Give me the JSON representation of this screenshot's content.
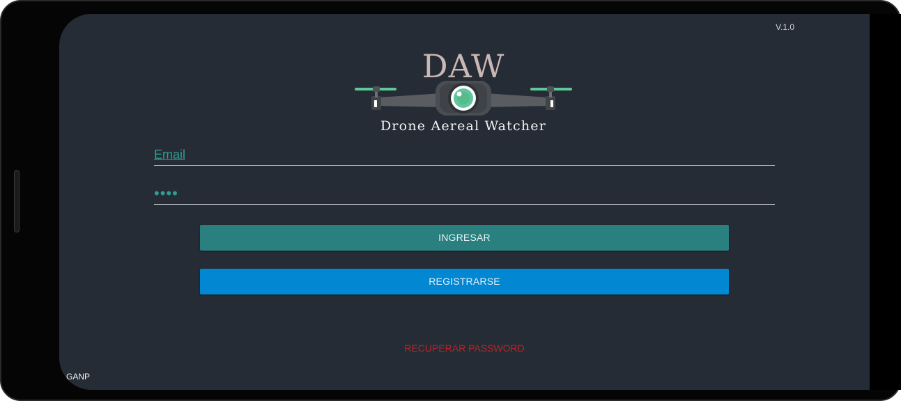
{
  "app": {
    "version": "V.1.0",
    "logo_title": "DAW",
    "logo_subtitle": "Drone Aereal Watcher",
    "footer_tag": "GANP"
  },
  "login_form": {
    "email_placeholder": "Email",
    "password_value": "••••",
    "login_label": "INGRESAR",
    "register_label": "REGISTRARSE",
    "recover_label": "RECUPERAR PASSWORD"
  },
  "colors": {
    "background": "#252c35",
    "accent_teal": "#2a807e",
    "accent_blue": "#0287d3",
    "field_text": "#2e9e92",
    "recover_red": "#b3262a",
    "logo_title": "#c9b7b3",
    "drone_eye": "#5fc79b"
  },
  "icons": {
    "logo": "drone-camera-icon"
  }
}
